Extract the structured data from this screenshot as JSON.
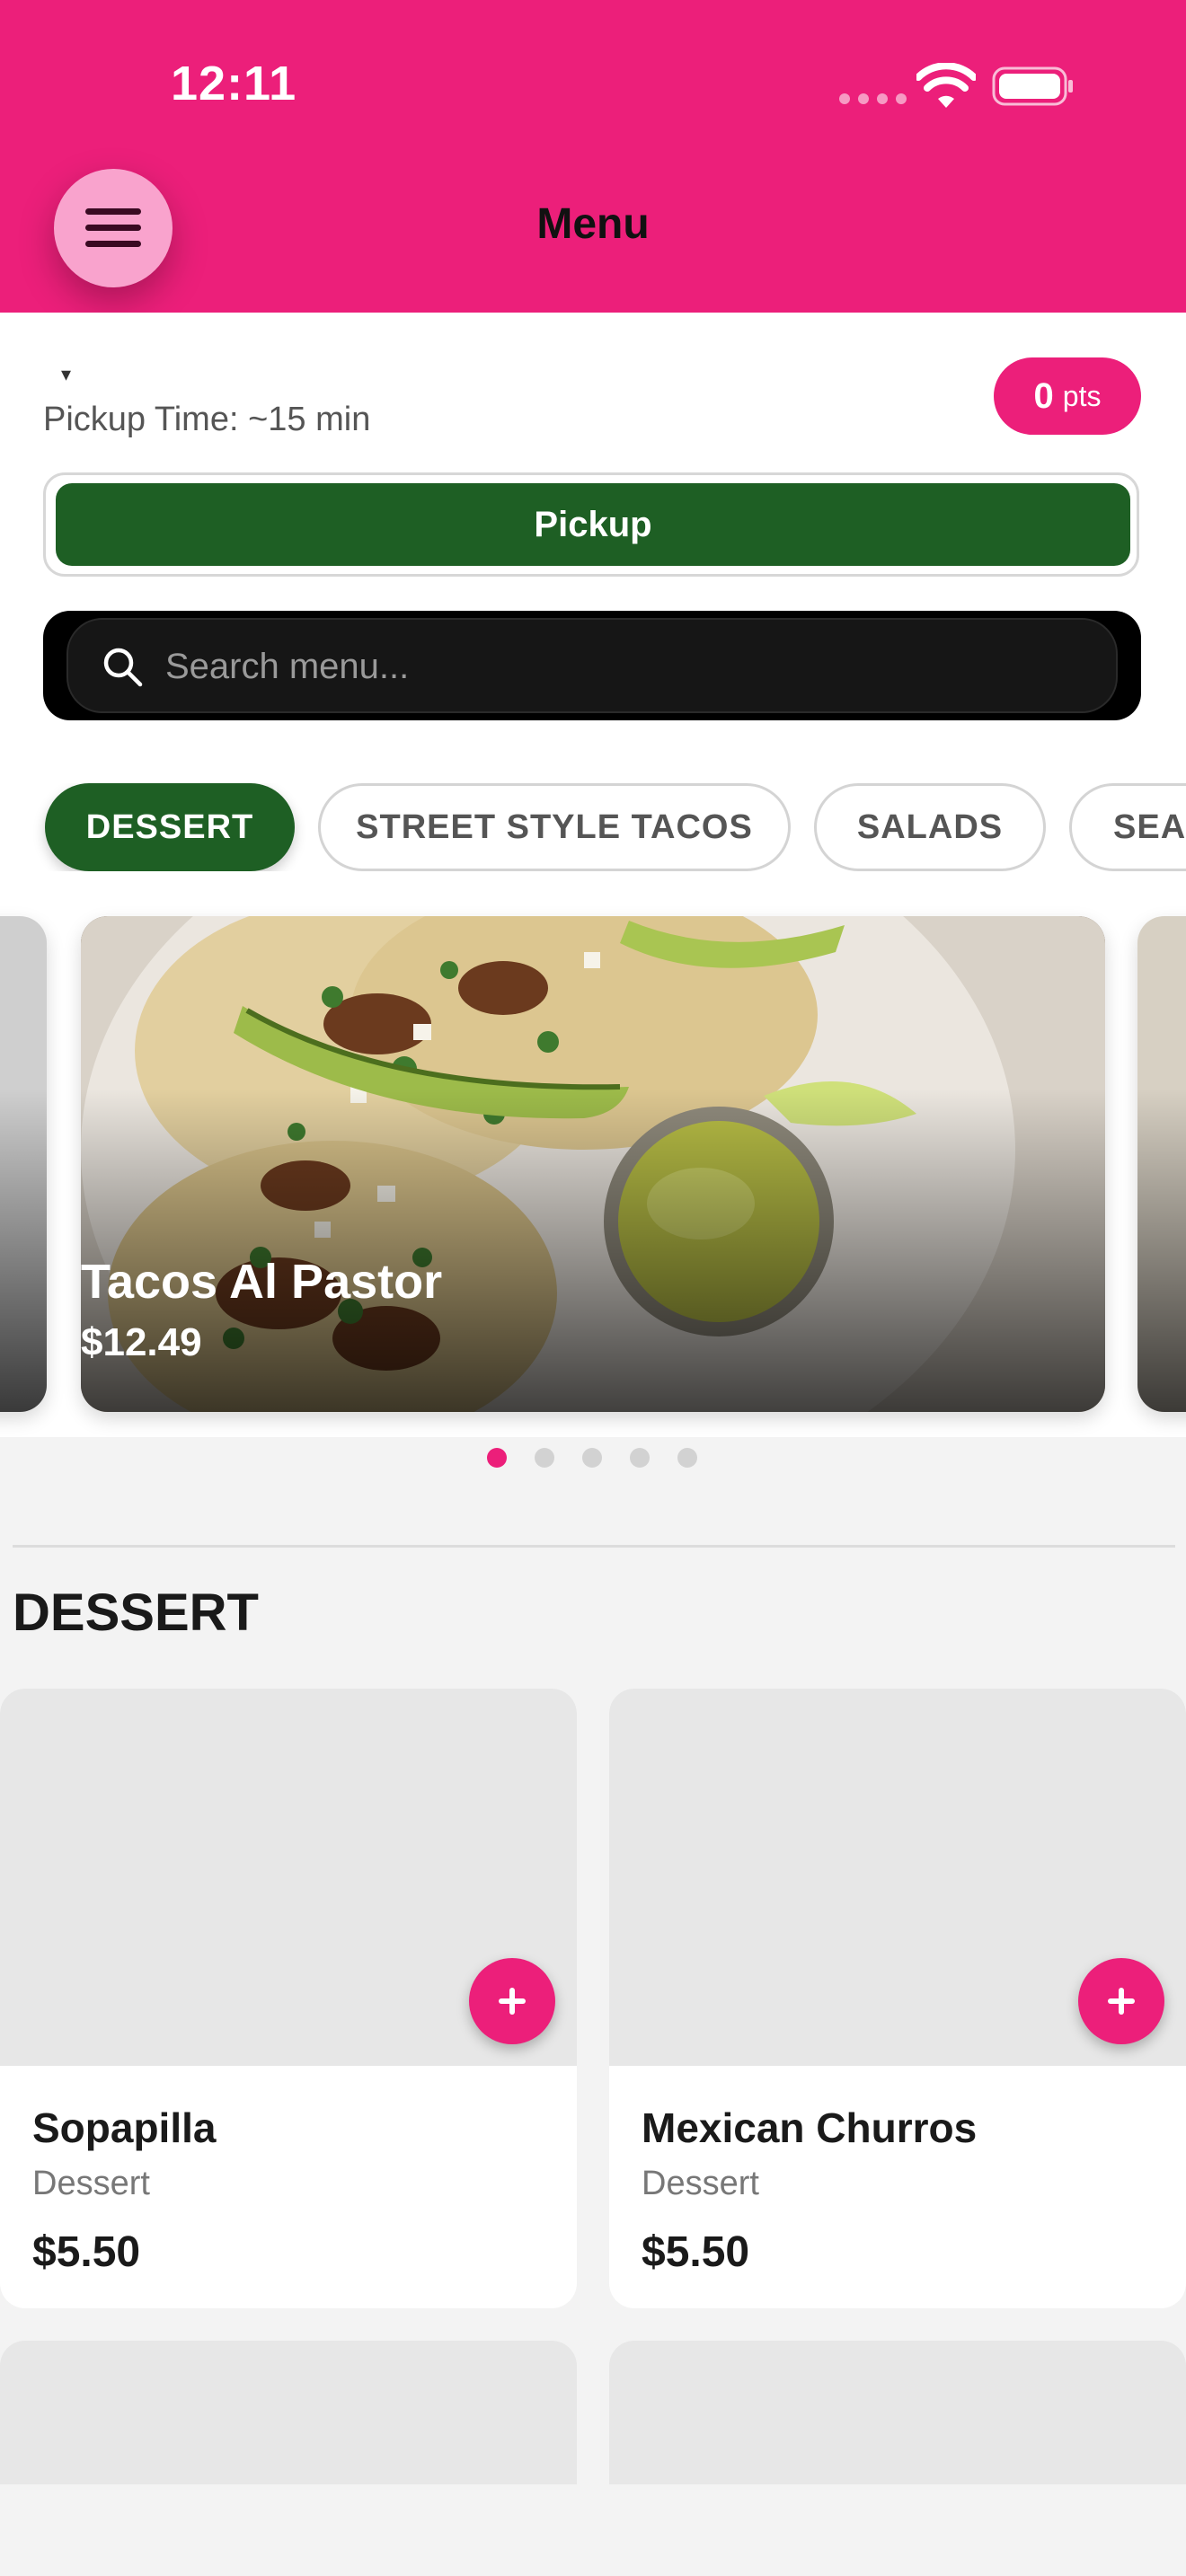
{
  "status_bar": {
    "time": "12:11"
  },
  "header": {
    "title": "Menu"
  },
  "top": {
    "caret": "▾",
    "pickup_time": "Pickup Time: ~15 min",
    "points_value": "0",
    "points_unit": "pts",
    "pickup_button": "Pickup"
  },
  "search": {
    "placeholder": "Search menu..."
  },
  "categories": [
    "DESSERT",
    "STREET STYLE TACOS",
    "SALADS",
    "SEAFOOD"
  ],
  "carousel": {
    "title": "Tacos Al Pastor",
    "price": "$12.49",
    "active_index": 0,
    "count": 5
  },
  "section": {
    "title": "DESSERT",
    "items": [
      {
        "name": "Sopapilla",
        "category": "Dessert",
        "price": "$5.50"
      },
      {
        "name": "Mexican Churros",
        "category": "Dessert",
        "price": "$5.50"
      }
    ]
  },
  "colors": {
    "brand": "#ec1f7a",
    "active_green": "#1e5f24",
    "light_pink": "#f9a3cd"
  },
  "icons": [
    "menu-icon",
    "wifi-icon",
    "battery-icon",
    "search-icon",
    "plus-icon"
  ]
}
